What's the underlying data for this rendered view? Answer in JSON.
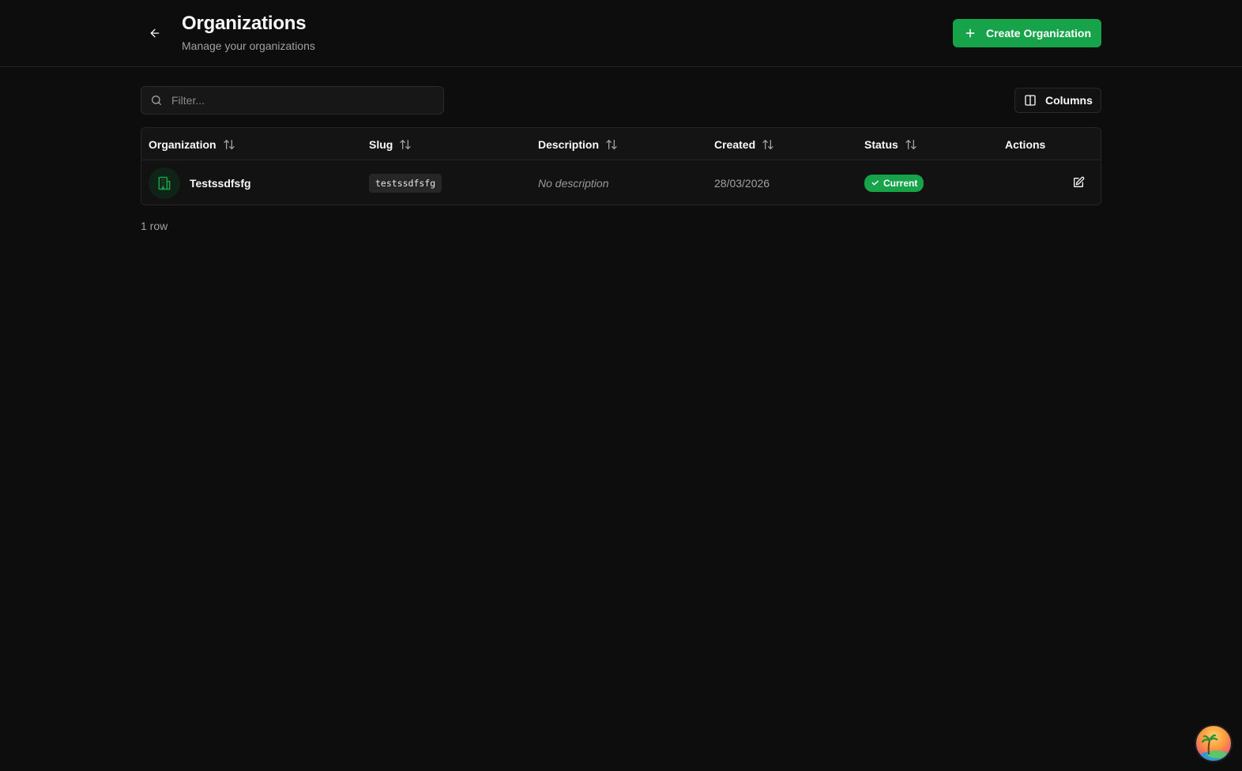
{
  "header": {
    "title": "Organizations",
    "subtitle": "Manage your organizations",
    "create_label": "Create Organization"
  },
  "toolbar": {
    "filter_placeholder": "Filter...",
    "filter_value": "",
    "columns_label": "Columns"
  },
  "table": {
    "columns": [
      "Organization",
      "Slug",
      "Description",
      "Created",
      "Status",
      "Actions"
    ],
    "rows": [
      {
        "organization": "Testssdfsfg",
        "slug": "testssdfsfg",
        "description": "No description",
        "created": "28/03/2026",
        "status": "Current"
      }
    ],
    "row_count": "1 row"
  },
  "colors": {
    "accent": "#16a34a",
    "background": "#0d0d0d",
    "border": "#262626"
  },
  "icons": {
    "back": "arrow-left-icon",
    "create": "plus-icon",
    "filter": "search-icon",
    "columns": "columns-icon",
    "sort": "sort-arrows-icon",
    "org": "building-icon",
    "status": "check-icon",
    "edit": "edit-icon"
  }
}
